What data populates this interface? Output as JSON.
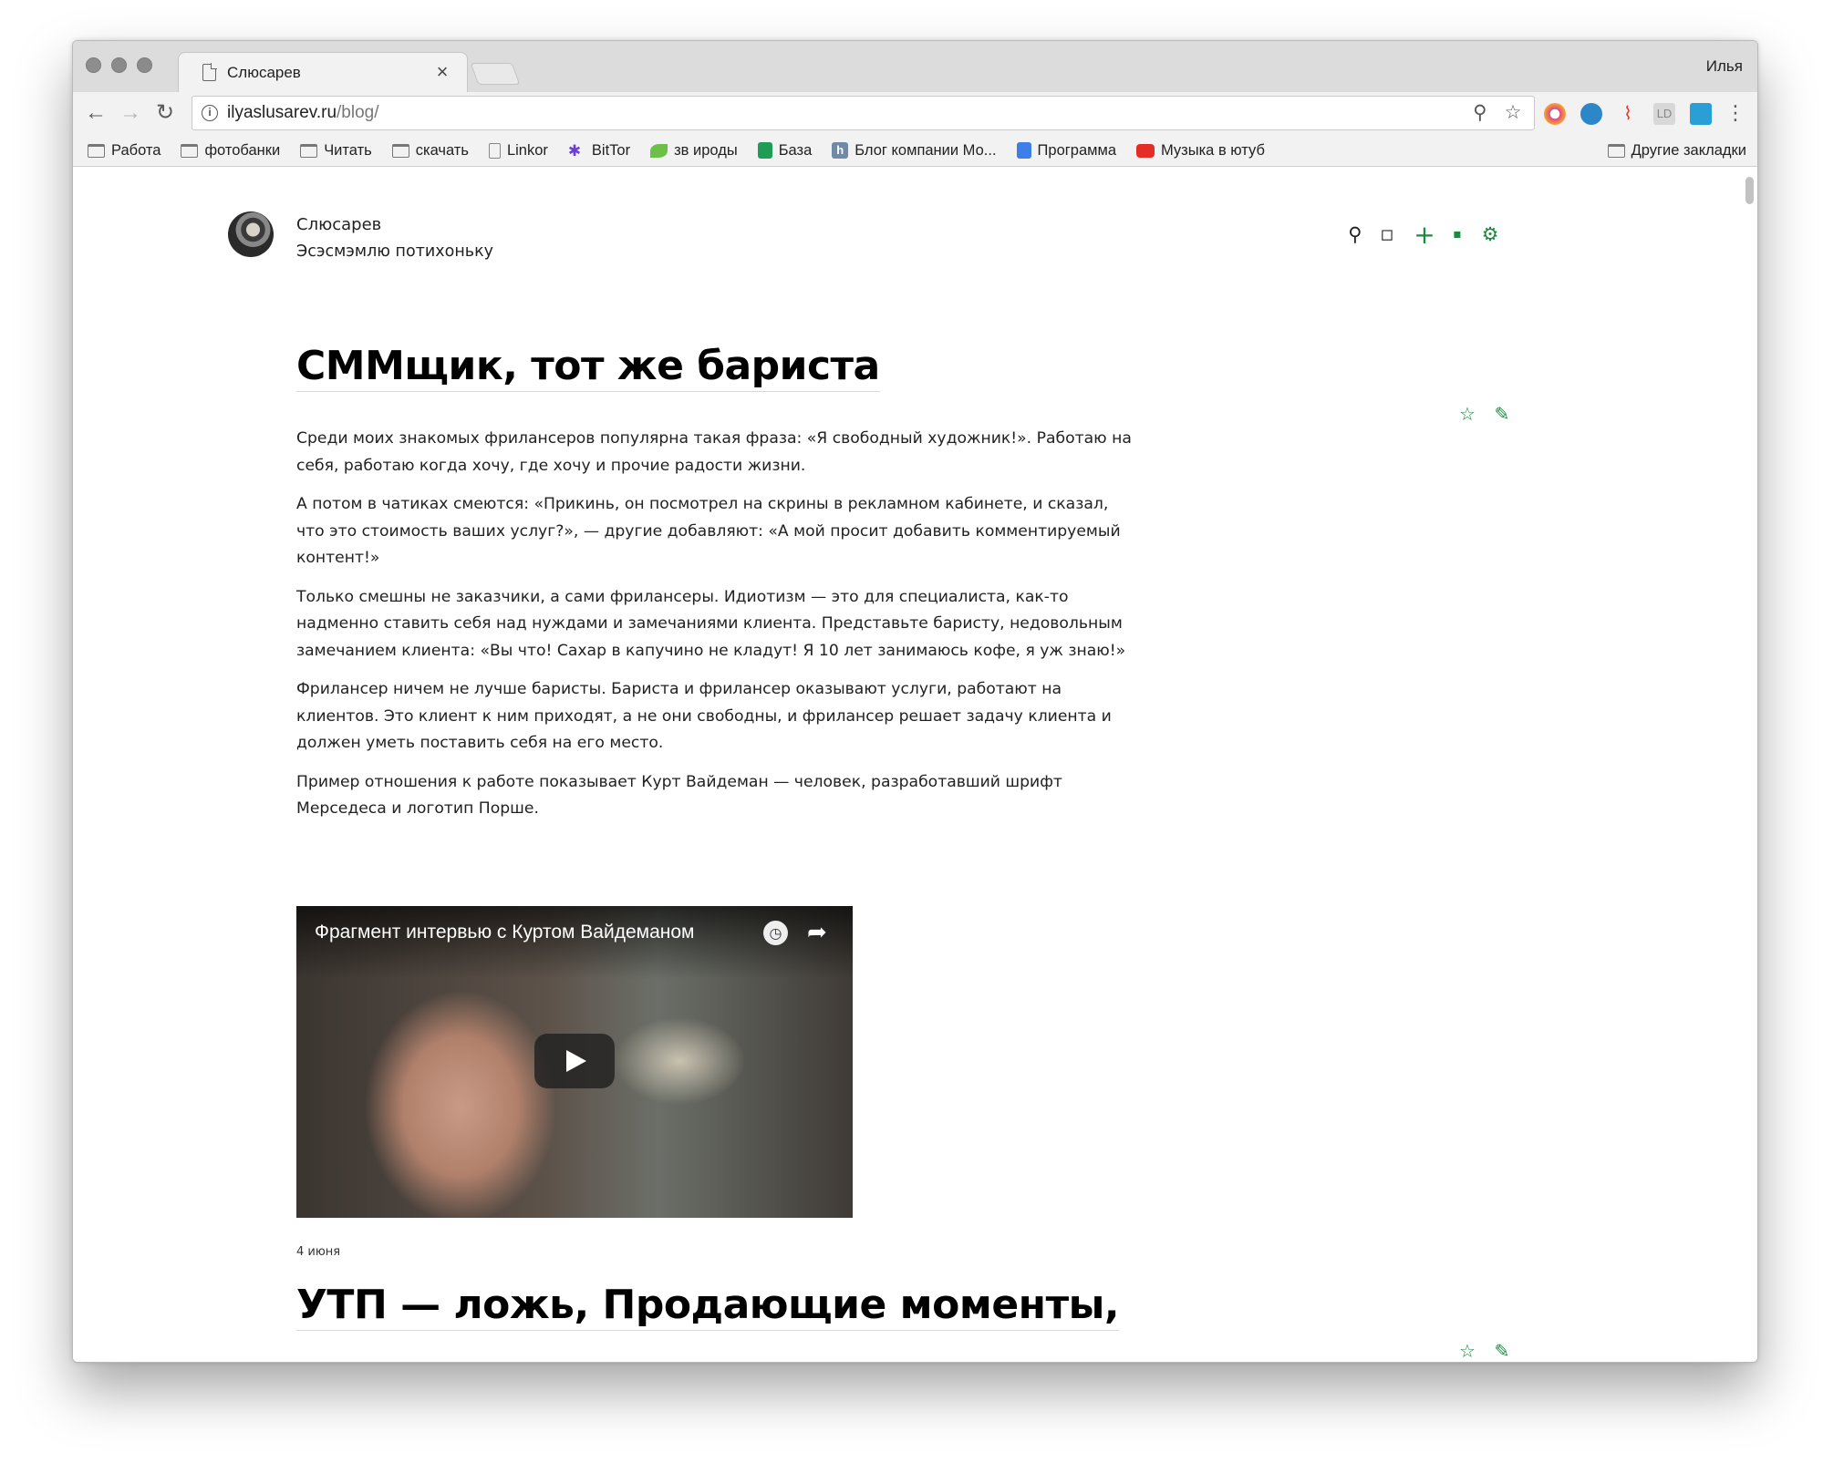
{
  "browser": {
    "tab_title": "Слюсарев",
    "tab_close": "×",
    "profile_name": "Илья",
    "url_host": "ilyaslusarev.ru",
    "url_path": "/blog/",
    "nav": {
      "back": "←",
      "forward": "→",
      "reload": "↻"
    },
    "info_glyph": "i",
    "zoom_glyph": "⚲",
    "star_glyph": "☆",
    "menu_glyph": "⋮",
    "bookmarks": [
      {
        "label": "Работа",
        "icon": "folder-icon"
      },
      {
        "label": "фотобанки",
        "icon": "folder-icon"
      },
      {
        "label": "Читать",
        "icon": "folder-icon"
      },
      {
        "label": "скачать",
        "icon": "folder-icon"
      },
      {
        "label": "Linkor",
        "icon": "page-icon"
      },
      {
        "label": "BitTor",
        "icon": "bittorrent-icon"
      },
      {
        "label": "зв ироды",
        "icon": "leaf-icon"
      },
      {
        "label": "База",
        "icon": "sheets-icon"
      },
      {
        "label": "Блог компании Мо...",
        "icon": "habr-icon"
      },
      {
        "label": "Программа",
        "icon": "docs-icon"
      },
      {
        "label": "Музыка в ютуб",
        "icon": "youtube-icon"
      }
    ],
    "other_bookmarks": "Другие закладки"
  },
  "blog": {
    "author": "Слюсарев",
    "tagline": "Эсэсмэмлю потихоньку",
    "actions": {
      "search": "⚲",
      "tag": "◇",
      "add": "+",
      "grid": "▪",
      "settings": "⚙"
    },
    "accent_color": "#1a8a3c"
  },
  "post": {
    "title": "СММщик, тот же бариста",
    "favorite_glyph": "☆",
    "edit_glyph": "✎",
    "paragraphs": [
      "Среди моих знакомых фрилансеров популярна такая фраза: «Я свободный художник!». Работаю на себя, работаю когда хочу, где хочу и прочие радости жизни.",
      "А потом в чатиках смеются: «Прикинь, он посмотрел на скрины в рекламном кабинете, и сказал, что это стоимость ваших услуг?», — другие добавляют: «А мой просит добавить комментируемый контент!»",
      "Только смешны не заказчики, а сами фрилансеры. Идиотизм — это для специалиста, как-то надменно ставить себя над нуждами и замечаниями клиента. Представьте баристу, недовольным замечанием клиента: «Вы что! Сахар в капучино не кладут! Я 10 лет занимаюсь кофе, я уж знаю!»",
      "Фрилансер ничем не лучше баристы. Бариста и фрилансер оказывают услуги, работают на клиентов. Это клиент к ним приходят, а не они свободны, и фрилансер решает задачу клиента и должен уметь поставить себя на его место.",
      "Пример отношения к работе показывает Курт Вайдеман — человек, разработавший шрифт Мерседеса и логотип Порше."
    ],
    "video_title": "Фрагмент интервью с Куртом Вайдеманом",
    "video_clock": "◷",
    "video_share": "➦",
    "date": "4 июня"
  },
  "next_post": {
    "title": "УТП — ложь, Продающие моменты,",
    "favorite_glyph": "☆",
    "edit_glyph": "✎"
  }
}
